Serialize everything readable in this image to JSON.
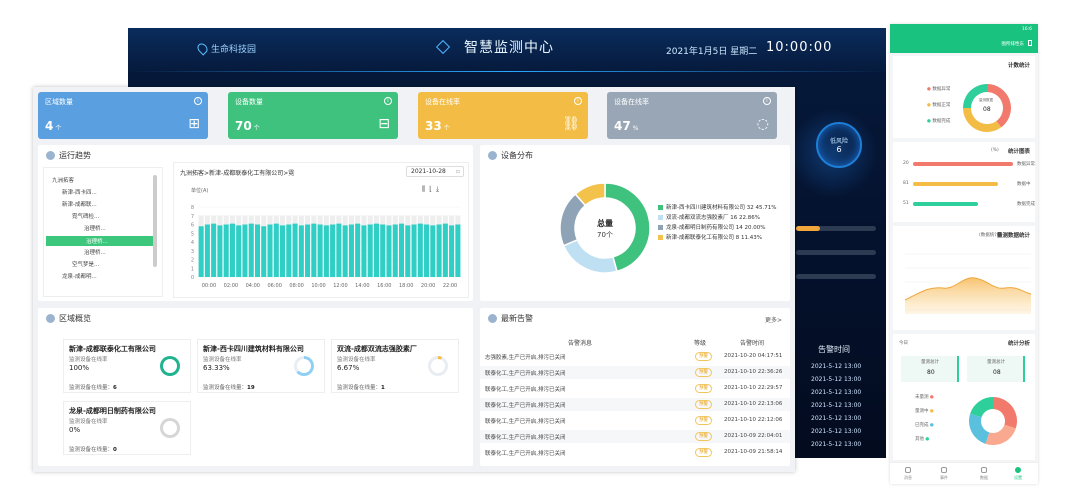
{
  "dark": {
    "park": "生命科技园",
    "title": "智慧监测中心",
    "date": "2021年1月5日 星期二",
    "clock": "10:00:00",
    "ring_label": "低风险",
    "ring_value": "6",
    "table_header": "告警时间",
    "times": [
      "2021-5-12  13:00",
      "2021-5-12  13:00",
      "2021-5-12  13:00",
      "2021-5-12  13:00",
      "2021-5-12  13:00",
      "2021-5-12  13:00",
      "2021-5-12  13:00"
    ]
  },
  "cards": [
    {
      "label": "区域数量",
      "value": "4",
      "unit": "个",
      "color": "#5a9fe0",
      "icon": "org-chart-icon"
    },
    {
      "label": "设备数量",
      "value": "70",
      "unit": "个",
      "color": "#3fc27e",
      "icon": "router-icon"
    },
    {
      "label": "设备在线率",
      "value": "33",
      "unit": "个",
      "color": "#f3bd45",
      "icon": "link-icon"
    },
    {
      "label": "设备在线率",
      "value": "47",
      "unit": "%",
      "color": "#98a6b5",
      "icon": "refresh-ring-icon"
    }
  ],
  "trend": {
    "title": "运行趋势",
    "tree": [
      "九洲拓客",
      "新津-西卡四...",
      "新津-成都联...",
      "霓气碑检...",
      "治理桥...",
      "治理桥...",
      "治理桥...",
      "空气梦是...",
      "龙泉-成都明..."
    ],
    "breadcrumb": "九洲拓客>新津-成都联泰化工有限公司>霓",
    "date_value": "2021-10-28",
    "unit_label": "单位(A)"
  },
  "chart_data": {
    "type": "bar",
    "categories": [
      "00:00",
      "02:00",
      "04:00",
      "06:00",
      "08:00",
      "10:00",
      "12:00",
      "14:00",
      "16:00",
      "18:00",
      "20:00",
      "22:00"
    ],
    "ylim": [
      0,
      8
    ],
    "yticks": [
      "0",
      "1",
      "2",
      "3",
      "4",
      "5",
      "6",
      "7",
      "8"
    ],
    "values": [
      5.8,
      6.0,
      6.1,
      5.9,
      6.0,
      6.1,
      5.9,
      6.0,
      6.1,
      6.0,
      5.8,
      6.0,
      6.1,
      5.9,
      6.0,
      6.1,
      5.9,
      6.0,
      6.1,
      6.0,
      5.9,
      6.0,
      6.1,
      5.9,
      6.0,
      6.1,
      5.9,
      6.0,
      6.1,
      6.0,
      5.9,
      6.0,
      6.1,
      5.9,
      6.0,
      6.1,
      6.0,
      5.9,
      6.0,
      6.1,
      5.9,
      6.0
    ],
    "background_max": 7,
    "bar_color": "#2fcfc6"
  },
  "distribution": {
    "title": "设备分布",
    "center_label": "总量",
    "center_value": "70个",
    "slices": [
      {
        "name": "新津-西卡四川建筑材料有限公司",
        "value": 32,
        "pct": "45.71%",
        "color": "#3fc27e"
      },
      {
        "name": "双流-成都双流志强胶素厂",
        "value": 16,
        "pct": "22.86%",
        "color": "#bfe0f2"
      },
      {
        "name": "龙泉-成都明日制药有限公司",
        "value": 14,
        "pct": "20.00%",
        "color": "#8fa3b7"
      },
      {
        "name": "新津-成都联泰化工有限公司",
        "value": 8,
        "pct": "11.43%",
        "color": "#f3c24a"
      }
    ]
  },
  "regions": {
    "title": "区域概览",
    "sub_label": "监测设备在线率",
    "count_label": "监测设备在线量：",
    "items": [
      {
        "name": "新津-成都联泰化工有限公司",
        "pct": "100%",
        "count": "6",
        "ring": "#1fb38f",
        "level": 1.0
      },
      {
        "name": "新津-西卡四川建筑材料有限公司",
        "pct": "63.33%",
        "count": "19",
        "ring": "#8fd0f2",
        "level": 0.6333
      },
      {
        "name": "双流-成都双流志强胶素厂",
        "pct": "6.67%",
        "count": "1",
        "ring": "#f3bd45",
        "level": 0.0667
      },
      {
        "name": "龙泉-成都明日制药有限公司",
        "pct": "0%",
        "count": "0",
        "ring": "#cccccc",
        "level": 0
      }
    ]
  },
  "alarms": {
    "title": "最新告警",
    "more": "更多>",
    "headers": [
      "告警消息",
      "等级",
      "告警时间"
    ],
    "rows": [
      {
        "msg": "志强胶素,生产已开启,排污已关闭",
        "level": "预警",
        "time": "2021-10-20 04:17:51"
      },
      {
        "msg": "联泰化工,生产已开启,排污已关闭",
        "level": "预警",
        "time": "2021-10-10 22:36:26"
      },
      {
        "msg": "联泰化工,生产已开启,排污已关闭",
        "level": "预警",
        "time": "2021-10-10 22:29:57"
      },
      {
        "msg": "联泰化工,生产已开启,排污已关闭",
        "level": "预警",
        "time": "2021-10-10 22:13:06"
      },
      {
        "msg": "联泰化工,生产已开启,排污已关闭",
        "level": "预警",
        "time": "2021-10-10 22:12:06"
      },
      {
        "msg": "联泰化工,生产已开启,排污已关闭",
        "level": "预警",
        "time": "2021-10-09 22:04:01"
      },
      {
        "msg": "联泰化工,生产已开启,排污已关闭",
        "level": "预警",
        "time": "2021-10-09 21:58:14"
      }
    ]
  },
  "mobile": {
    "status_time": "16:6",
    "header_right": "图所排性东",
    "card1_title": "计数统计",
    "card1_center_top": "量测数据",
    "card1_center_value": "08",
    "card1_legend": [
      "数据异常",
      "数据正常",
      "数据完成"
    ],
    "card2_title": "统计图表",
    "card2_sub": "(%)",
    "bars": [
      {
        "label": "数据异常",
        "value": "20",
        "color": "#f27a6c",
        "level": 1.0
      },
      {
        "label": "数据中",
        "value": "81",
        "color": "#f3bd45",
        "level": 0.85
      },
      {
        "label": "数据完成",
        "value": "51",
        "color": "#2fcf9b",
        "level": 0.65
      }
    ],
    "card3_title": "量测数据统计",
    "card3_sub": "(数据统计)",
    "card4_title": "统计分析",
    "card4_left": "今日",
    "box1_label": "量测总计",
    "box1_value": "80",
    "box2_label": "量测总计",
    "box2_value": "08",
    "card4_legend": [
      "未量测",
      "量测中",
      "已完成",
      "其他"
    ],
    "nav": [
      "消息",
      "事件",
      "数据",
      "设置"
    ]
  }
}
